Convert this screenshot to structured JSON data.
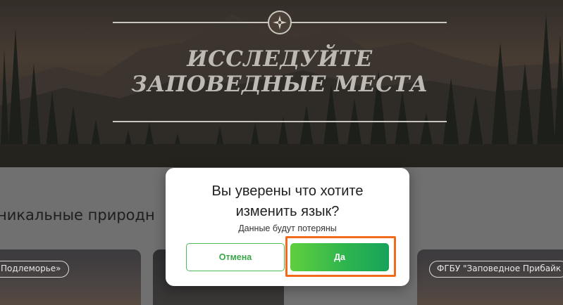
{
  "hero": {
    "title_line1": "Исследуйте",
    "title_line2": "заповедные места"
  },
  "section": {
    "title": "никальные природн"
  },
  "cards": [
    {
      "tag": "Подлеморье»"
    },
    {
      "tag": ""
    },
    {
      "tag": "ФГБУ \"Заповедное Прибайк"
    }
  ],
  "dialog": {
    "title_line1": "Вы уверены что хотите",
    "title_line2": "изменить язык?",
    "subtitle": "Данные будут потеряны",
    "cancel_label": "Отмена",
    "confirm_label": "Да"
  },
  "colors": {
    "accent_green": "#2fb54e",
    "highlight_orange": "#f26a1b"
  },
  "icons": {
    "hero_emblem": "compass-icon"
  }
}
